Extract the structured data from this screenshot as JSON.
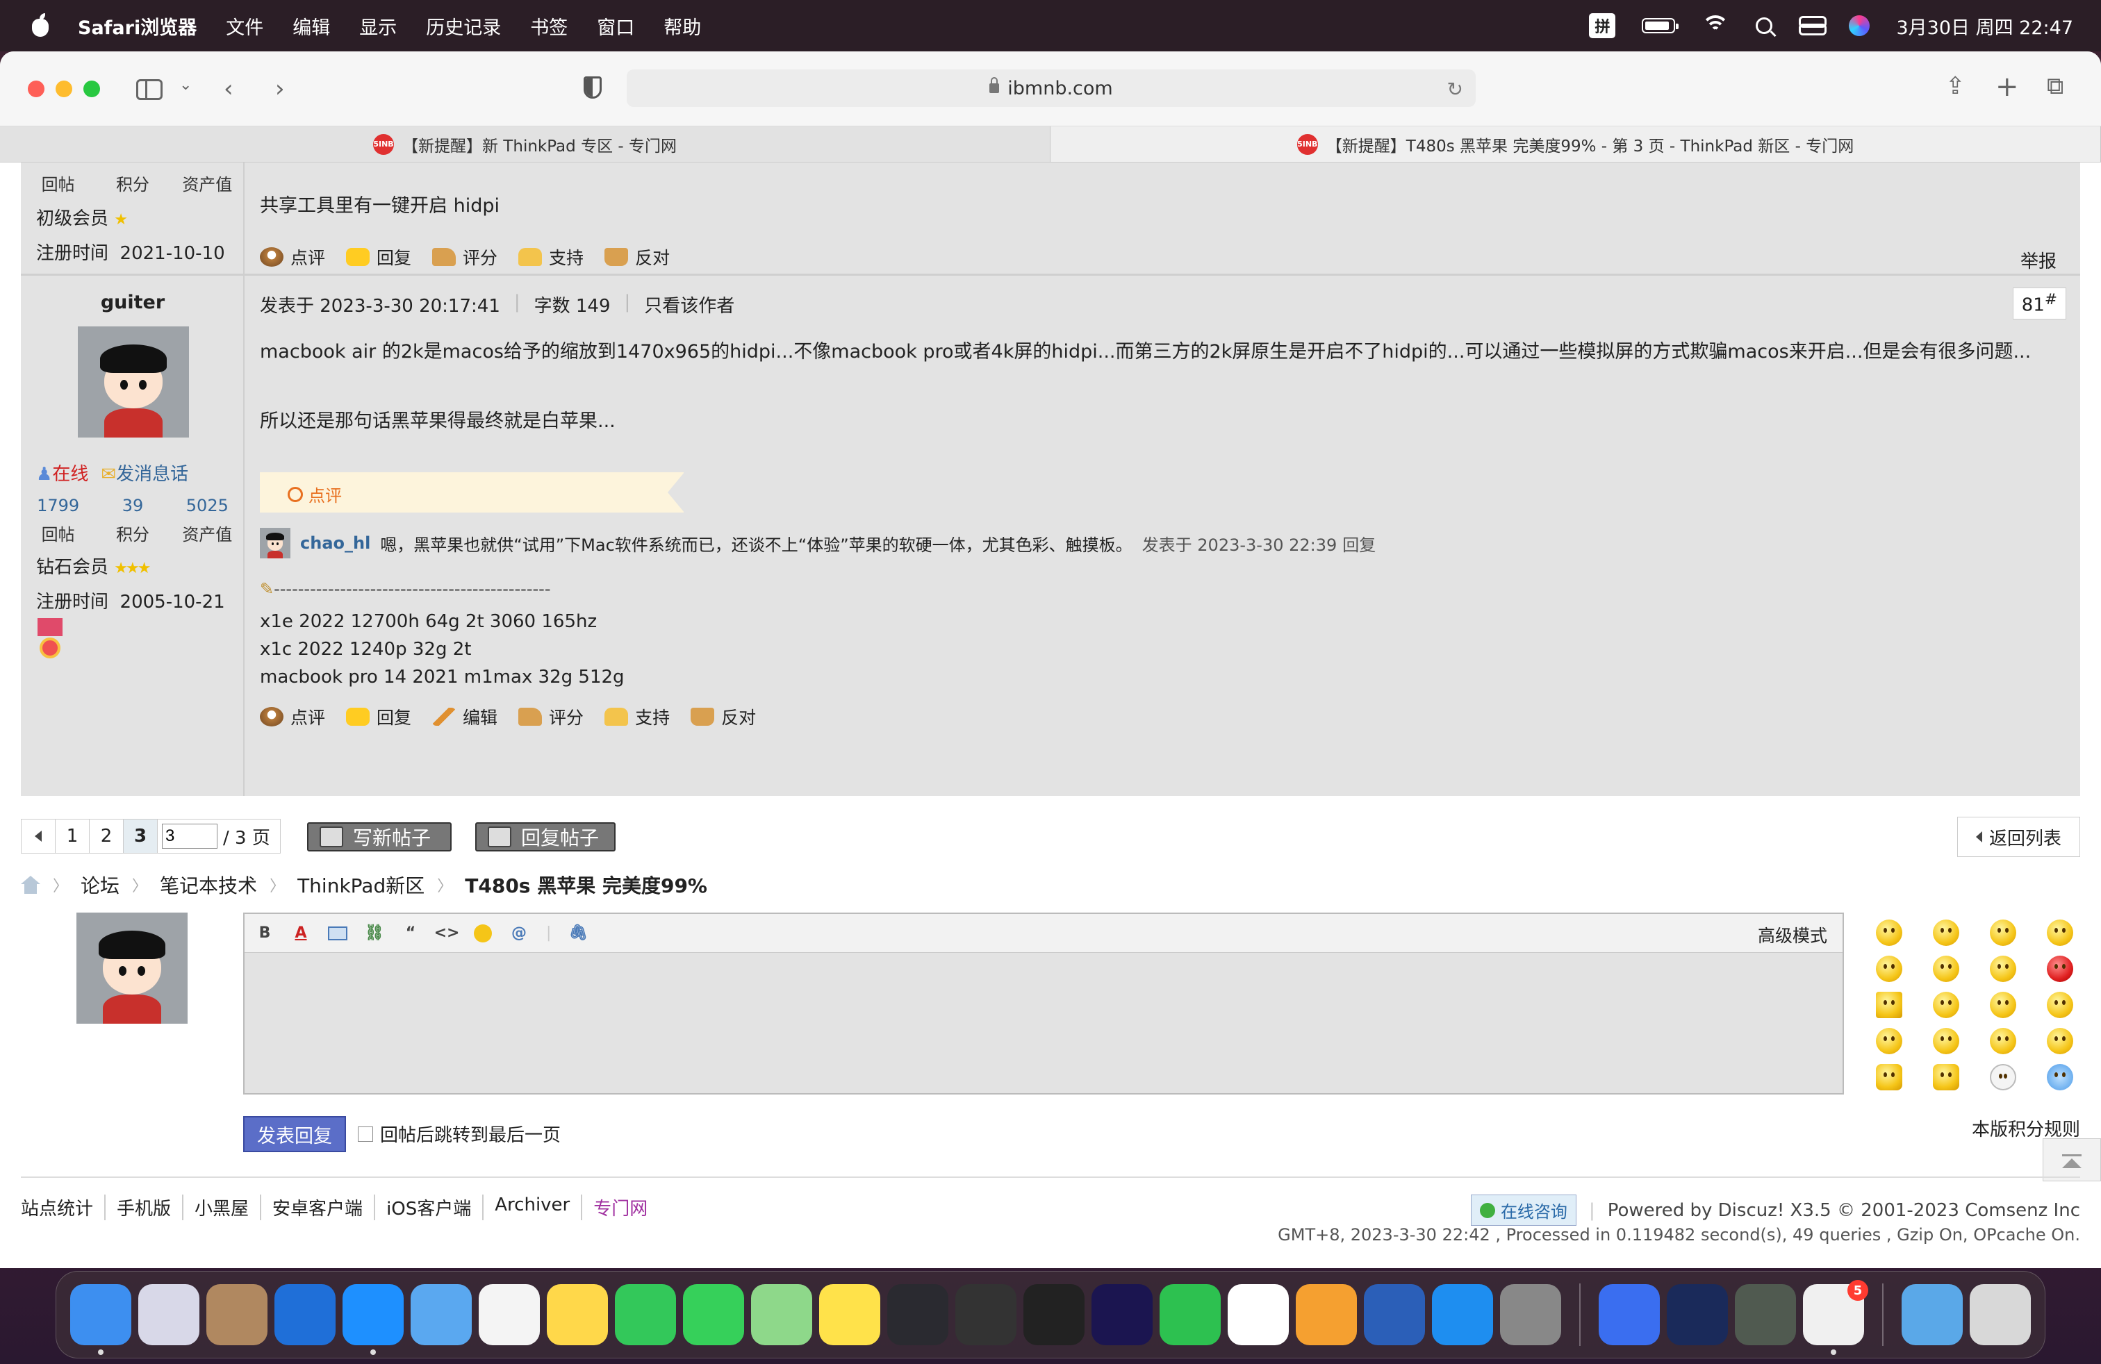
{
  "menubar": {
    "app_name": "Safari浏览器",
    "items": [
      "文件",
      "编辑",
      "显示",
      "历史记录",
      "书签",
      "窗口",
      "帮助"
    ],
    "ime": "拼",
    "datetime": "3月30日 周四 22:47"
  },
  "browser": {
    "url": "ibmnb.com",
    "tabs": [
      {
        "label": "【新提醒】新 ThinkPad 专区 - 专门网",
        "favicon": "5INB"
      },
      {
        "label": "【新提醒】T480s 黑苹果 完美度99% - 第 3 页 - ThinkPad 新区 - 专门网",
        "favicon": "5INB"
      }
    ]
  },
  "prev_post": {
    "stats_labels": [
      "回帖",
      "积分",
      "资产值"
    ],
    "rank": "初级会员",
    "reg_label": "注册时间",
    "reg_date": "2021-10-10",
    "content": "共享工具里有一键开启 hidpi",
    "actions": [
      "点评",
      "回复",
      "评分",
      "支持",
      "反对"
    ],
    "report": "举报"
  },
  "post": {
    "author": "guiter",
    "online": "在线",
    "message": "发消息话",
    "stats": [
      "1799",
      "39",
      "5025"
    ],
    "stats_labels": [
      "回帖",
      "积分",
      "资产值"
    ],
    "rank": "钻石会员",
    "reg_label": "注册时间",
    "reg_date": "2005-10-21",
    "meta_posted": "发表于 2023-3-30 20:17:41",
    "meta_words": "字数 149",
    "meta_only": "只看该作者",
    "floor": "81",
    "floor_suffix": "#",
    "body_1": "macbook air 的2k是macos给予的缩放到1470x965的hidpi...不像macbook pro或者4k屏的hidpi...而第三方的2k屏原生是开启不了hidpi的...可以通过一些模拟屏的方式欺骗macos来开启...但是会有很多问题...",
    "body_2": "所以还是那句话黑苹果得最终就是白苹果...",
    "comment_label": "点评",
    "comment_user": "chao_hl",
    "comment_text": "嗯，黑苹果也就供“试用”下Mac软件系统而已，还谈不上“体验”苹果的软硬一体，尤其色彩、触摸板。",
    "comment_meta": "发表于 2023-3-30 22:39",
    "comment_reply": "回复",
    "sig_line": "----------------------------------------------",
    "sig_1": "x1e 2022 12700h 64g 2t 3060 165hz",
    "sig_2": "x1c 2022 1240p 32g 2t",
    "sig_3": "macbook pro 14 2021 m1max 32g 512g",
    "actions": [
      "点评",
      "回复",
      "编辑",
      "评分",
      "支持",
      "反对"
    ]
  },
  "pager": {
    "pages": [
      "1",
      "2",
      "3"
    ],
    "current": "3",
    "input_value": "3",
    "total": "/ 3 页",
    "new_post": "写新帖子",
    "reply_post": "回复帖子",
    "back_list": "返回列表"
  },
  "breadcrumb": [
    "论坛",
    "笔记本技术",
    "ThinkPad新区",
    "T480s 黑苹果 完美度99%"
  ],
  "editor": {
    "advanced": "高级模式",
    "submit": "发表回复",
    "jump_label": "回帖后跳转到最后一页",
    "rules": "本版积分规则"
  },
  "footer": {
    "links": [
      "站点统计",
      "手机版",
      "小黑屋",
      "安卓客户端",
      "iOS客户端",
      "Archiver",
      "专门网"
    ],
    "consult": "在线咨询",
    "powered": "Powered by Discuz! X3.5 © 2001-2023 Comsenz Inc",
    "gmt": "GMT+8, 2023-3-30 22:42 , Processed in 0.119482 second(s), 49 queries , Gzip On, OPcache On."
  },
  "dock": {
    "apps": [
      {
        "name": "finder",
        "color": "#3d8ff0"
      },
      {
        "name": "launchpad",
        "color": "#d8d8e8"
      },
      {
        "name": "contacts",
        "color": "#b08860"
      },
      {
        "name": "maxthon",
        "color": "#1f6fd8"
      },
      {
        "name": "safari",
        "color": "#1e90ff"
      },
      {
        "name": "mail",
        "color": "#5aa8f0"
      },
      {
        "name": "reminders",
        "color": "#f4f4f4"
      },
      {
        "name": "notes",
        "color": "#ffd84a"
      },
      {
        "name": "facetime",
        "color": "#33c85a"
      },
      {
        "name": "messages",
        "color": "#36d05a"
      },
      {
        "name": "maps",
        "color": "#8ed88a"
      },
      {
        "name": "music-app",
        "color": "#ffe24a"
      },
      {
        "name": "infuse",
        "color": "#2a2a30"
      },
      {
        "name": "dvd-player",
        "color": "#333"
      },
      {
        "name": "final-cut",
        "color": "#222"
      },
      {
        "name": "premiere",
        "color": "#1b1550"
      },
      {
        "name": "wechat",
        "color": "#2dc150"
      },
      {
        "name": "qq",
        "color": "#fff"
      },
      {
        "name": "pages",
        "color": "#f5a030"
      },
      {
        "name": "word",
        "color": "#2b5fb8"
      },
      {
        "name": "app-store",
        "color": "#1e8ef0"
      },
      {
        "name": "system-preferences",
        "color": "#888"
      },
      {
        "name": "lark",
        "color": "#3a6ef0"
      },
      {
        "name": "infuse-2",
        "color": "#1a2a5a"
      },
      {
        "name": "disk-tool",
        "color": "#505a50"
      },
      {
        "name": "office",
        "color": "#f0f0f0"
      },
      {
        "name": "downloads-folder",
        "color": "#5aa8e8"
      },
      {
        "name": "trash",
        "color": "#d8d8d8"
      }
    ],
    "office_badge": "5"
  }
}
